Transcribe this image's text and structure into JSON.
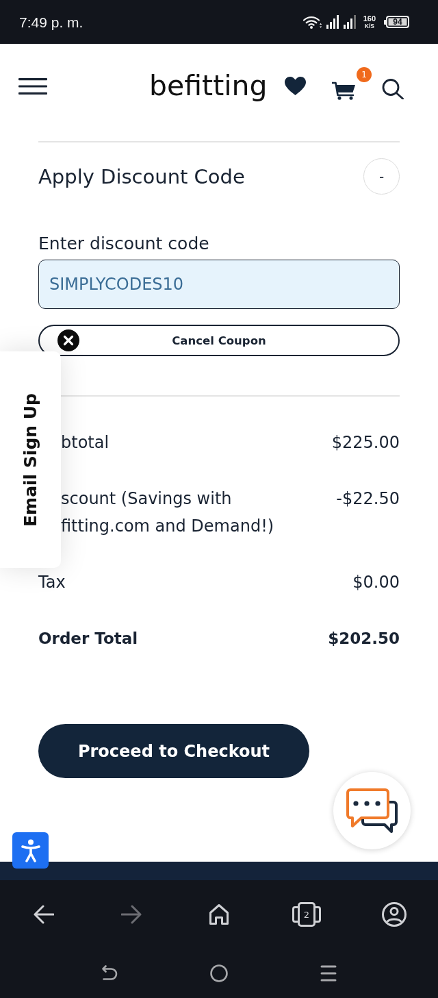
{
  "status_bar": {
    "time": "7:49 p. m.",
    "speed": "160",
    "speed_unit": "K/S",
    "battery": "94"
  },
  "header": {
    "logo": "befitting",
    "cart_count": "1"
  },
  "discount": {
    "title": "Apply Discount Code",
    "toggle": "-",
    "field_label": "Enter discount code",
    "code": "SIMPLYCODES10",
    "cancel_button": "Cancel Coupon"
  },
  "email_tab": {
    "label": "Email Sign Up"
  },
  "summary": {
    "rows": [
      {
        "kind": "line",
        "label": "btotal",
        "value": "$225.00"
      },
      {
        "kind": "line",
        "label": "scount (Savings with fitting.com and Demand!)",
        "value": "-$22.50"
      },
      {
        "kind": "line",
        "label": "Tax",
        "value": "$0.00"
      },
      {
        "kind": "total",
        "label": "Order Total",
        "value": "$202.50"
      }
    ]
  },
  "checkout_button": "Proceed to Checkout",
  "browser_toolbar": {
    "items": [
      {
        "kind": "back",
        "disabled": false
      },
      {
        "kind": "forward",
        "disabled": true
      },
      {
        "kind": "home",
        "disabled": false
      },
      {
        "kind": "tabs",
        "count": "2",
        "disabled": false
      },
      {
        "kind": "account",
        "disabled": false
      }
    ]
  },
  "system_nav": {
    "items": [
      {
        "kind": "back"
      },
      {
        "kind": "home"
      },
      {
        "kind": "recents"
      }
    ]
  }
}
